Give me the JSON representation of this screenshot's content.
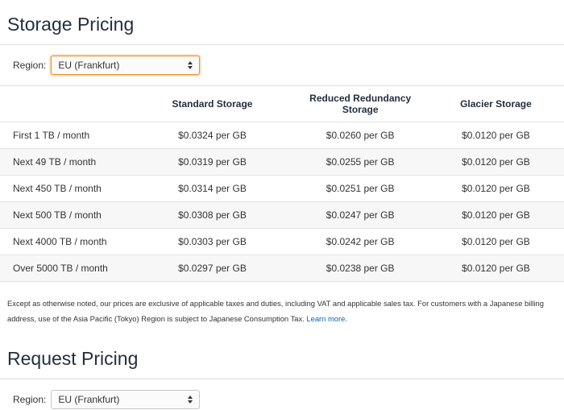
{
  "storage": {
    "title": "Storage Pricing",
    "region_label": "Region:",
    "region_value": "EU (Frankfurt)",
    "columns": [
      "",
      "Standard Storage",
      "Reduced Redundancy Storage",
      "Glacier Storage"
    ],
    "rows": [
      [
        "First 1 TB / month",
        "$0.0324 per GB",
        "$0.0260 per GB",
        "$0.0120 per GB"
      ],
      [
        "Next 49 TB / month",
        "$0.0319 per GB",
        "$0.0255 per GB",
        "$0.0120 per GB"
      ],
      [
        "Next 450 TB / month",
        "$0.0314 per GB",
        "$0.0251 per GB",
        "$0.0120 per GB"
      ],
      [
        "Next 500 TB / month",
        "$0.0308 per GB",
        "$0.0247 per GB",
        "$0.0120 per GB"
      ],
      [
        "Next 4000 TB / month",
        "$0.0303 per GB",
        "$0.0242 per GB",
        "$0.0120 per GB"
      ],
      [
        "Over 5000 TB / month",
        "$0.0297 per GB",
        "$0.0238 per GB",
        "$0.0120 per GB"
      ]
    ],
    "footnote_text": "Except as otherwise noted, our prices are exclusive of applicable taxes and duties, including VAT and applicable sales tax. For customers with a Japanese billing address, use of the Asia Pacific (Tokyo) Region is subject to Japanese Consumption Tax.",
    "footnote_link": "Learn more."
  },
  "request": {
    "title": "Request Pricing",
    "region_label": "Region:",
    "region_value": "EU (Frankfurt)"
  },
  "colors": {
    "title": "#232f3e",
    "link": "#0066c0",
    "focus_border": "#ec912c",
    "alt_row": "#f7f7f7"
  },
  "icons": [
    "select-arrows-icon"
  ]
}
